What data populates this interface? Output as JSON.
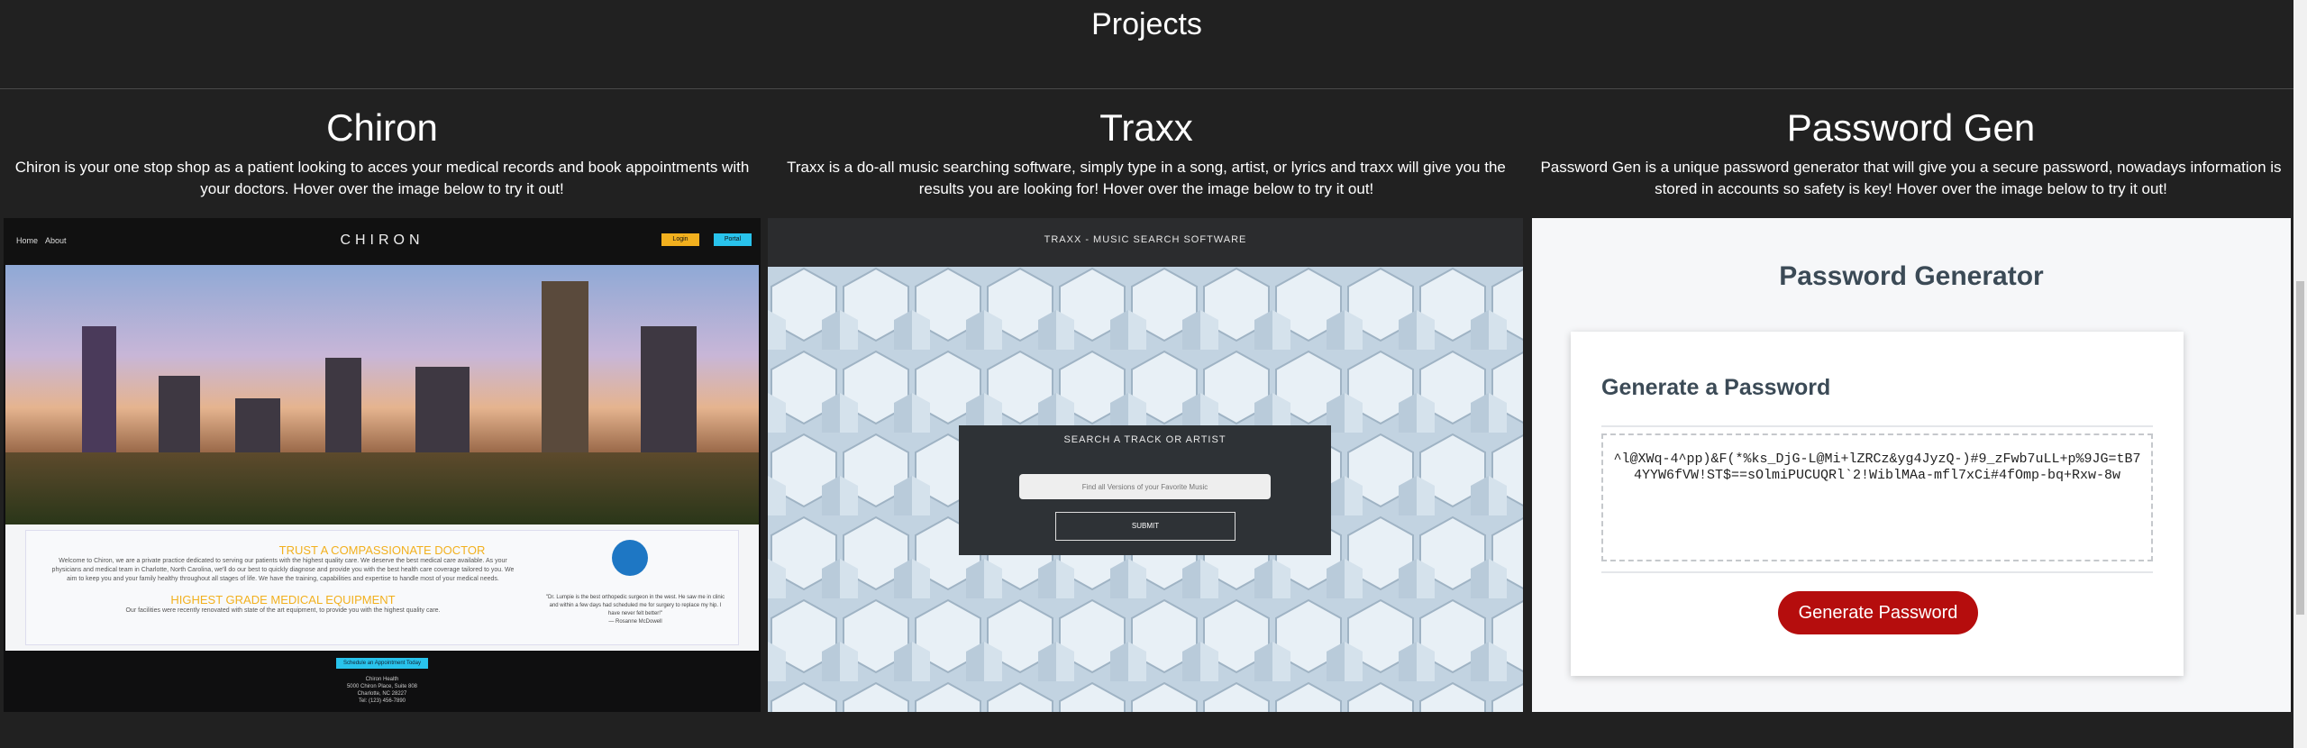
{
  "page": {
    "heading": "Projects"
  },
  "projects": [
    {
      "title": "Chiron",
      "description": "Chiron is your one stop shop as a patient looking to acces your medical records and book appointments with your doctors. Hover over the image below to try it out!",
      "preview": {
        "nav": [
          "Home",
          "About"
        ],
        "brand": "CHIRON",
        "login_label": "Login",
        "portal_label": "Portal",
        "heading_1": "TRUST A COMPASSIONATE DOCTOR",
        "paragraph_1": "Welcome to Chiron, we are a private practice dedicated to serving our patients with the highest quality care. We deserve the best medical care available. As your physicians and medical team in Charlotte, North Carolina, we'll do our best to quickly diagnose and provide you with the best health care coverage tailored to you. We aim to keep you and your family healthy throughout all stages of life. We have the training, capabilities and expertise to handle most of your medical needs.",
        "heading_2": "HIGHEST GRADE MEDICAL EQUIPMENT",
        "paragraph_2": "Our facilities were recently renovated with state of the art equipment, to provide you with the highest quality care.",
        "quote": "\"Dr. Lumpie is the best orthopedic surgeon in the west. He saw me in clinic and within a few days had scheduled me for surgery to replace my hip. I have never felt better!\"",
        "quote_author": "— Rosanne McDowell",
        "cta": "Schedule an Appointment Today",
        "footer": [
          "Chiron Health",
          "5000 Chiron Place, Suite 808",
          "Charlotte, NC 28227",
          "Tel: (123) 456-7890"
        ]
      }
    },
    {
      "title": "Traxx",
      "description": "Traxx is a do-all music searching software, simply type in a song, artist, or lyrics and traxx will give you the results you are looking for! Hover over the image below to try it out!",
      "preview": {
        "header": "TRAXX - MUSIC SEARCH SOFTWARE",
        "panel_heading": "SEARCH A TRACK OR ARTIST",
        "input_placeholder": "Find all Versions of your Favorite Music",
        "submit_label": "SUBMIT"
      }
    },
    {
      "title": "Password Gen",
      "description": "Password Gen is a unique password generator that will give you a secure password, nowadays information is stored in accounts so safety is key! Hover over the image below to try it out!",
      "preview": {
        "heading": "Password Generator",
        "card_heading": "Generate a Password",
        "password": "^l@XWq-4^pp)&F(*%ks_DjG-L@Mi+lZRCz&yg4JyzQ-)#9_zFwb7uLL+p%9JG=tB74YYW6fVW!ST$==sOlmiPUCUQRl`2!WiblMAa-mfl7xCi#4fOmp-bq+Rxw-8w",
        "button_label": "Generate Password"
      }
    }
  ],
  "colors": {
    "background": "#212121",
    "password_button": "#b50d0d",
    "chiron_accent": "#f2b01e",
    "chiron_cta": "#29c3ec"
  }
}
